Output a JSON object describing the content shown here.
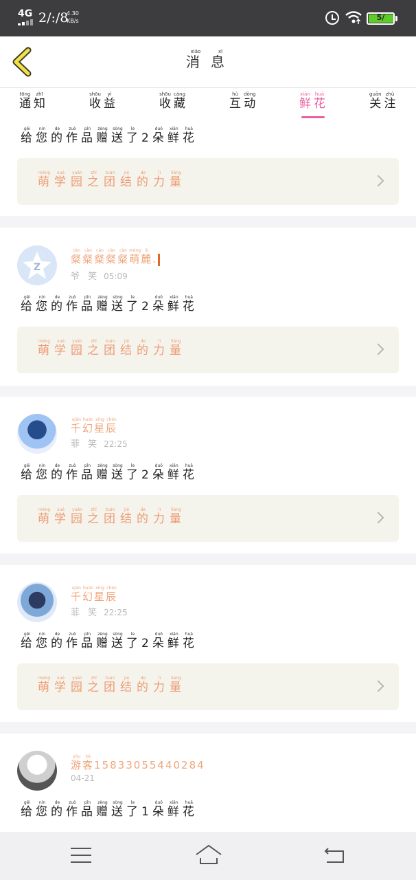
{
  "status_bar": {
    "network": "4G",
    "time": "2/:/8",
    "speed_value": "4.30",
    "speed_unit": "KB/s",
    "battery_level": "5/"
  },
  "header": {
    "title": [
      {
        "char": "消",
        "pinyin": "xiāo"
      },
      {
        "char": "息",
        "pinyin": "xī"
      }
    ]
  },
  "tabs": [
    {
      "label": [
        {
          "char": "通",
          "pinyin": "tōng"
        },
        {
          "char": "知",
          "pinyin": "zhī"
        }
      ],
      "active": false
    },
    {
      "label": [
        {
          "char": "收",
          "pinyin": "shōu"
        },
        {
          "char": "益",
          "pinyin": "yì"
        }
      ],
      "active": false
    },
    {
      "label": [
        {
          "char": "收",
          "pinyin": "shōu"
        },
        {
          "char": "藏",
          "pinyin": "cáng"
        }
      ],
      "active": false
    },
    {
      "label": [
        {
          "char": "互",
          "pinyin": "hù"
        },
        {
          "char": "动",
          "pinyin": "dòng"
        }
      ],
      "active": false
    },
    {
      "label": [
        {
          "char": "鲜",
          "pinyin": "xiān"
        },
        {
          "char": "花",
          "pinyin": "huā"
        }
      ],
      "active": true
    },
    {
      "label": [
        {
          "char": "关",
          "pinyin": "guān"
        },
        {
          "char": "注",
          "pinyin": "zhù"
        }
      ],
      "active": false
    }
  ],
  "accent_color": "#ea5f9e",
  "work_title": [
    {
      "char": "萌",
      "pinyin": "méng"
    },
    {
      "char": "学",
      "pinyin": "xué"
    },
    {
      "char": "园",
      "pinyin": "yuán"
    },
    {
      "char": "之",
      "pinyin": "zhī"
    },
    {
      "char": "团",
      "pinyin": "tuán"
    },
    {
      "char": "结",
      "pinyin": "jié"
    },
    {
      "char": "的",
      "pinyin": "de"
    },
    {
      "char": "力",
      "pinyin": "lì"
    },
    {
      "char": "量",
      "pinyin": "liàng"
    }
  ],
  "message_prefix": [
    {
      "char": "给",
      "pinyin": "gěi"
    },
    {
      "char": "您",
      "pinyin": "nín"
    },
    {
      "char": "的",
      "pinyin": "de"
    },
    {
      "char": "作",
      "pinyin": "zuò"
    },
    {
      "char": "品",
      "pinyin": "pǐn"
    },
    {
      "char": "赠",
      "pinyin": "zèng"
    },
    {
      "char": "送",
      "pinyin": "sòng"
    },
    {
      "char": "了",
      "pinyin": "le"
    }
  ],
  "message_suffix": [
    {
      "char": "朵",
      "pinyin": "duǒ"
    },
    {
      "char": "鲜",
      "pinyin": "xiān"
    },
    {
      "char": "花",
      "pinyin": "huā"
    }
  ],
  "items": [
    {
      "has_user": false,
      "count": "2"
    },
    {
      "has_user": true,
      "avatar": "qq-default-avatar",
      "name": "粲粲粲粲粲萌麓.",
      "name_pinyin": [
        "càn",
        "càn",
        "càn",
        "càn",
        "càn",
        "méng",
        "lù",
        ""
      ],
      "role": "爷 笑",
      "time": "05:09",
      "count": "2"
    },
    {
      "has_user": true,
      "avatar": "photo-avatar",
      "name": "千幻星辰",
      "name_pinyin": [
        "qiān",
        "huàn",
        "xīng",
        "chén"
      ],
      "role": "菲 笑",
      "time": "22:25",
      "count": "2"
    },
    {
      "has_user": true,
      "avatar": "photo-avatar",
      "name": "千幻星辰",
      "name_pinyin": [
        "qiān",
        "huàn",
        "xīng",
        "chén"
      ],
      "role": "菲 笑",
      "time": "22:25",
      "count": "2"
    },
    {
      "has_user": true,
      "avatar": "photo-avatar",
      "name": "游客15833055440284",
      "name_pinyin": [
        "yóu",
        "kè"
      ],
      "role": "",
      "time": "04-21",
      "count": "1"
    }
  ],
  "nav": {
    "icons": [
      "menu-icon",
      "home-icon",
      "back-icon"
    ]
  }
}
